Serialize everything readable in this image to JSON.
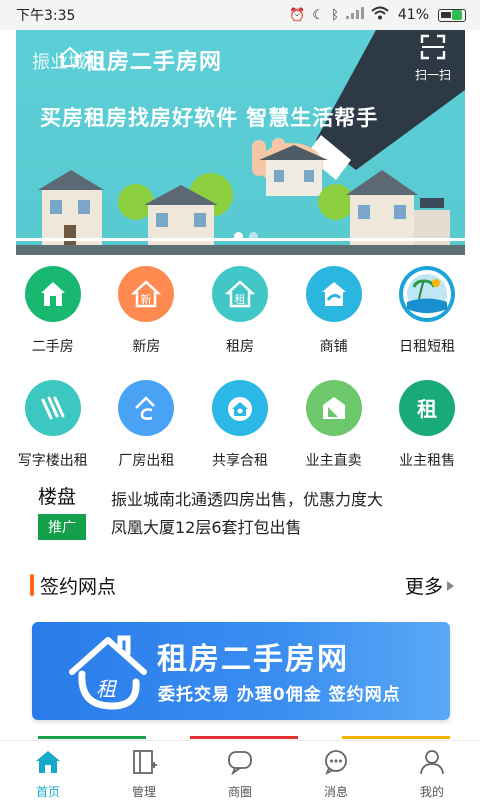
{
  "status_bar": {
    "time": "下午3:35",
    "battery": "41%",
    "icons": [
      "alarm-icon",
      "moon-icon",
      "bluetooth-icon",
      "signal-icon",
      "wifi-icon",
      "battery-icon"
    ]
  },
  "banner": {
    "overlay_text": "振业城1(",
    "title": "租房二手房网",
    "slogan": "买房租房找房好软件 智慧生活帮手",
    "scan_label": "扫一扫",
    "background_color": "#5ccfd6",
    "slides": 2,
    "active_slide": 0
  },
  "categories_row1": [
    {
      "label": "二手房",
      "icon": "house-icon",
      "color": "#18b870"
    },
    {
      "label": "新房",
      "icon": "new-house-icon",
      "color": "#ff8a50"
    },
    {
      "label": "租房",
      "icon": "rent-house-icon",
      "color": "#42c6c8"
    },
    {
      "label": "商铺",
      "icon": "shop-icon",
      "color": "#2bb6e0"
    },
    {
      "label": "日租短租",
      "icon": "beach-icon",
      "color": "#1aa4d8"
    }
  ],
  "categories_row2": [
    {
      "label": "写字楼出租",
      "icon": "office-icon",
      "color": "#3cc8c0"
    },
    {
      "label": "厂房出租",
      "icon": "factory-icon",
      "color": "#4aa2f4"
    },
    {
      "label": "共享合租",
      "icon": "shared-rent-icon",
      "color": "#2bb8e6"
    },
    {
      "label": "业主直卖",
      "icon": "owner-sell-icon",
      "color": "#6cc86a"
    },
    {
      "label": "业主租售",
      "icon": "owner-rent-icon",
      "color": "#1aaa78"
    }
  ],
  "ticker": {
    "title": "楼盘",
    "badge": "推广",
    "lines": [
      "振业城南北通透四房出售，优惠力度大",
      "凤凰大厦12层6套打包出售"
    ]
  },
  "section": {
    "title": "签约网点",
    "more": "更多",
    "accent": "#ff6a14"
  },
  "promo": {
    "title": "租房二手房网",
    "subtitle": "委托交易  办理0佣金  签约网点",
    "logo_text": "租"
  },
  "stripes": [
    "#18a04a",
    "#e23030",
    "#f2b200"
  ],
  "bottom_nav": [
    {
      "label": "首页",
      "icon": "home-icon",
      "active": true
    },
    {
      "label": "管理",
      "icon": "manage-icon",
      "active": false
    },
    {
      "label": "商圈",
      "icon": "chat-bubble-icon",
      "active": false
    },
    {
      "label": "消息",
      "icon": "message-icon",
      "active": false
    },
    {
      "label": "我的",
      "icon": "user-icon",
      "active": false
    }
  ],
  "accent_color": "#18a9c8"
}
